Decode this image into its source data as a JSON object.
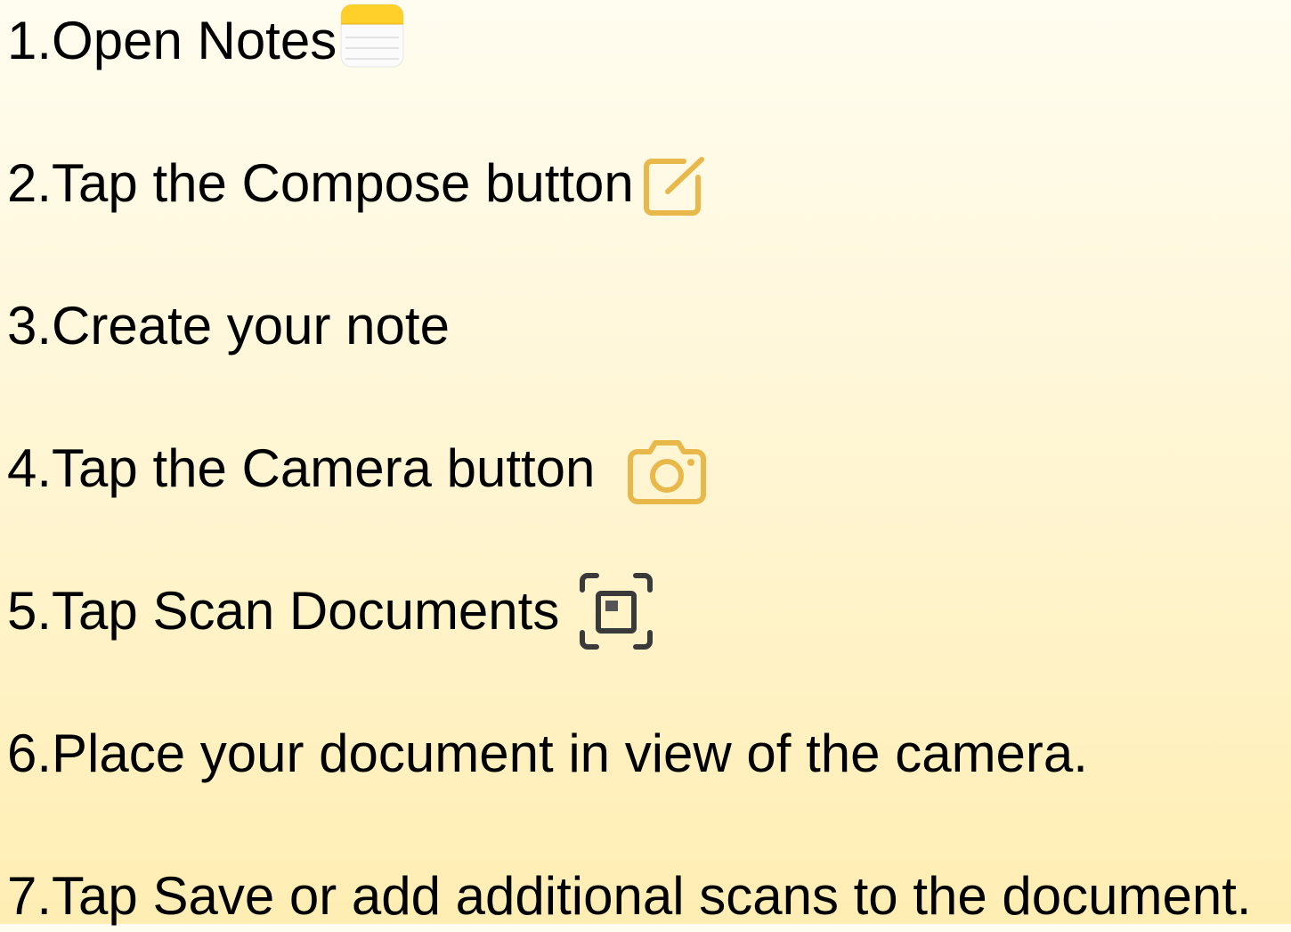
{
  "steps": [
    {
      "text": "1.Open Notes",
      "icon": "notes-app-icon"
    },
    {
      "text": "2.Tap the Compose button",
      "icon": "compose-icon"
    },
    {
      "text": "3.Create your note",
      "icon": ""
    },
    {
      "text": "4.Tap the Camera button",
      "icon": "camera-icon"
    },
    {
      "text": "5.Tap Scan Documents",
      "icon": "scan-documents-icon"
    },
    {
      "text": "6.Place your document in view of the camera.",
      "icon": ""
    },
    {
      "text": "7.Tap Save or add additional scans to the document.",
      "icon": ""
    }
  ],
  "colors": {
    "accent": "#e9b84a",
    "notes_yellow": "#ffd02a",
    "scan_gray": "#3a3a3a"
  }
}
